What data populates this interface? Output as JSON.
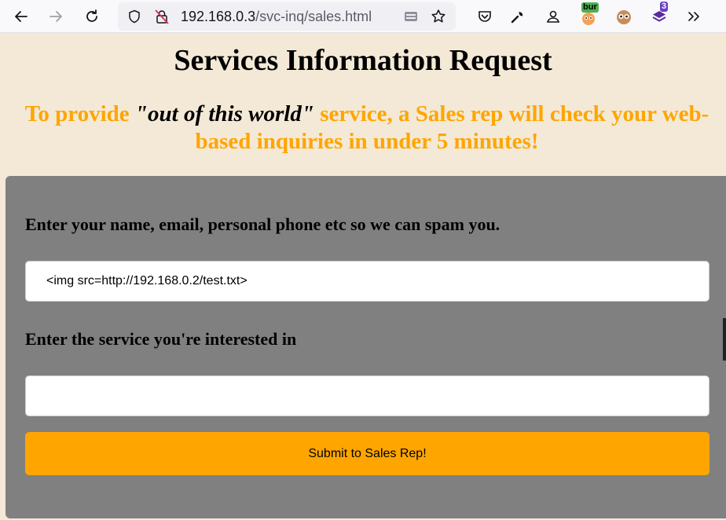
{
  "browser": {
    "url_host": "192.168.0.3",
    "url_path": "/svc-inq/sales.html",
    "extensions": {
      "burp_badge": "bur",
      "notification_badge": "3"
    },
    "icons": {
      "back": "back-arrow-icon",
      "forward": "forward-arrow-icon",
      "reload": "reload-icon",
      "site_info": "shield-icon",
      "insecure": "insecure-lock-icon",
      "reader": "reader-view-icon",
      "bookmark": "star-icon",
      "pocket": "pocket-icon",
      "tools": "wrench-icon",
      "account": "account-icon",
      "burp": "burp-extension-icon",
      "owl": "owl-extension-icon",
      "layers": "layers-extension-icon",
      "overflow": "overflow-menu-icon"
    }
  },
  "page": {
    "title": "Services Information Request",
    "tagline_before": "To provide ",
    "tagline_emphasis": "\"out of this world\"",
    "tagline_after": " service, a Sales rep will check your web-based inquiries in under 5 minutes!"
  },
  "form": {
    "contact_label": "Enter your name, email, personal phone etc so we can spam you.",
    "contact_value": "<img src=http://192.168.0.2/test.txt>",
    "service_label": "Enter the service you're interested in",
    "service_value": "",
    "submit_label": "Submit to Sales Rep!"
  },
  "colors": {
    "page_bg": "#f3e9d6",
    "accent": "#ffa500",
    "panel_bg": "#808080"
  }
}
